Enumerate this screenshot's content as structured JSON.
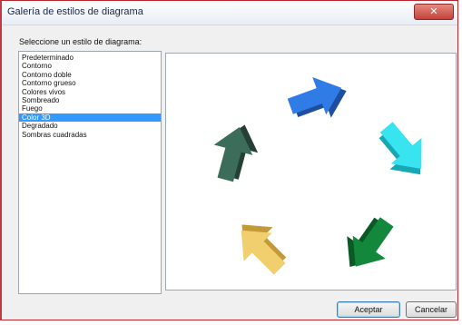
{
  "window": {
    "title": "Galería de estilos de diagrama",
    "close_glyph": "✕"
  },
  "prompt": "Seleccione un estilo de diagrama:",
  "styles": [
    {
      "label": "Predeterminado",
      "selected": false
    },
    {
      "label": "Contorno",
      "selected": false
    },
    {
      "label": "Contorno doble",
      "selected": false
    },
    {
      "label": "Contorno grueso",
      "selected": false
    },
    {
      "label": "Colores vivos",
      "selected": false
    },
    {
      "label": "Sombreado",
      "selected": false
    },
    {
      "label": "Fuego",
      "selected": false
    },
    {
      "label": "Color 3D",
      "selected": true
    },
    {
      "label": "Degradado",
      "selected": false
    },
    {
      "label": "Sombras cuadradas",
      "selected": false
    }
  ],
  "preview": {
    "arrows": [
      {
        "name": "blue-arrow",
        "color": "#2f7ce6",
        "side": "#1d4f9e"
      },
      {
        "name": "cyan-arrow",
        "color": "#37e4f0",
        "side": "#1aa7b5"
      },
      {
        "name": "green-arrow",
        "color": "#13883d",
        "side": "#0b5a26"
      },
      {
        "name": "yellow-arrow",
        "color": "#f2cf6e",
        "side": "#c49a36"
      },
      {
        "name": "dark-teal-arrow",
        "color": "#3c6d5a",
        "side": "#253f35"
      }
    ]
  },
  "buttons": {
    "ok": "Aceptar",
    "cancel": "Cancelar"
  }
}
